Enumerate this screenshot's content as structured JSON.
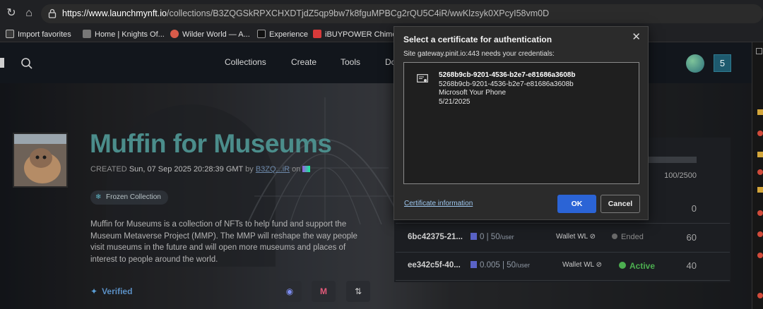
{
  "browser": {
    "url_host": "https://www.launchmynft.io",
    "url_path": "/collections/B3ZQGSkRPXCHXDTjdZ5qp9bw7k8fguMPBCg2rQU5C4iR/wwKlzsyk0XPcyI58vm0D",
    "bookmarks": [
      {
        "label": "Import favorites",
        "color": "#e8e8e8"
      },
      {
        "label": "Home | Knights Of...",
        "color": "#9a9a9a"
      },
      {
        "label": "Wilder World — A...",
        "color": "#d85b4a"
      },
      {
        "label": "Experience",
        "color": "#ffffff"
      },
      {
        "label": "iBUYPOWER Chimer...",
        "color": "#d83a3a"
      }
    ]
  },
  "site": {
    "nav": [
      "Collections",
      "Create",
      "Tools",
      "Do"
    ],
    "badge_count": "5",
    "collection": {
      "title": "Muffin for Museums",
      "created_label": "CREATED",
      "created_date": "Sun, 07 Sep 2025 20:28:39 GMT",
      "by_label": "by",
      "creator": "B3ZQ...iR",
      "on_label": "on",
      "frozen_label": "Frozen Collection",
      "description": "Muffin for Museums is a collection of NFTs to help fund and support the Museum Metaverse Project (MMP). The MMP will reshape the way people visit museums in the future and will open more museums and places of interest to people around the world.",
      "verified_label": "Verified"
    },
    "phases": {
      "rows": [
        {
          "id": "",
          "price": "",
          "limit": "",
          "wl": "",
          "status": "",
          "num": "100/2500"
        },
        {
          "id": "",
          "price": "",
          "limit": "",
          "wl": "",
          "status": "",
          "num": "0"
        },
        {
          "id": "6bc42375-21...",
          "price": "0",
          "limit": "| 50",
          "unit": "/user",
          "wl": "Wallet WL",
          "status": "Ended",
          "num": "60"
        },
        {
          "id": "ee342c5f-40...",
          "price": "0.005",
          "limit": "| 50",
          "unit": "/user",
          "wl": "Wallet WL",
          "status": "Active",
          "num": "40"
        }
      ]
    }
  },
  "dialog": {
    "title": "Select a certificate for authentication",
    "subtitle": "Site gateway.pinit.io:443 needs your credentials:",
    "cert": {
      "name": "5268b9cb-9201-4536-b2e7-e81686a3608b",
      "issued_to": "5268b9cb-9201-4536-b2e7-e81686a3608b",
      "issuer": "Microsoft Your Phone",
      "date": "5/21/2025"
    },
    "info_link": "Certificate information",
    "ok_label": "OK",
    "cancel_label": "Cancel"
  },
  "colors": {
    "title_teal": "#4b8d8b",
    "ok_blue": "#2b64d6",
    "active_green": "#4caf50",
    "ended_gray": "#8a8a8a"
  }
}
